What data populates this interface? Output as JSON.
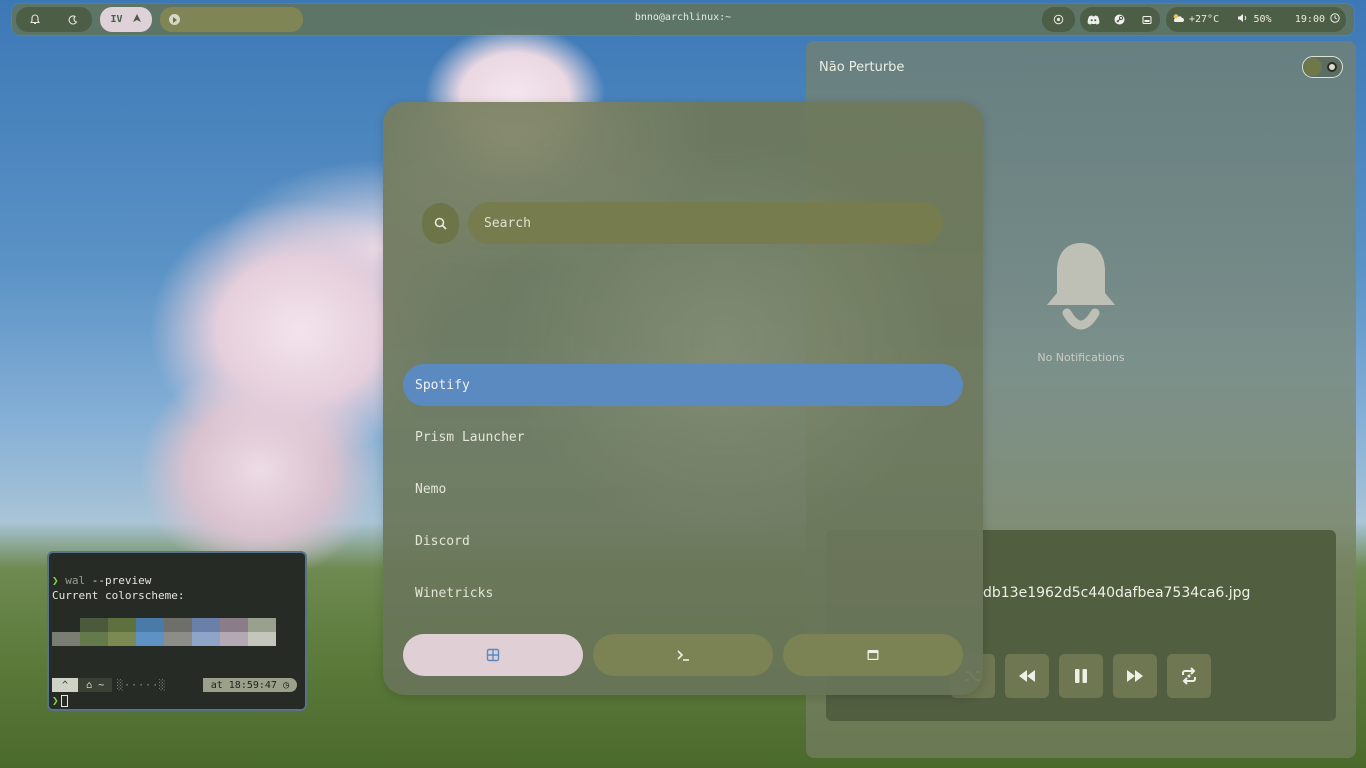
{
  "topbar": {
    "window_title": "bnno@archlinux:~",
    "workspace_label": "IV",
    "weather": "+27°C",
    "volume": "50%",
    "clock": "19:00"
  },
  "notifications": {
    "title": "Não Perturbe",
    "empty_text": "No Notifications",
    "dnd_enabled": false
  },
  "media": {
    "track_title": "db13e1962d5c440dafbea7534ca6.jpg"
  },
  "launcher": {
    "search_placeholder": "Search",
    "apps": [
      {
        "label": "Spotify",
        "selected": true
      },
      {
        "label": "Prism Launcher",
        "selected": false
      },
      {
        "label": "Nemo",
        "selected": false
      },
      {
        "label": "Discord",
        "selected": false
      },
      {
        "label": "Winetricks",
        "selected": false
      }
    ],
    "tabs": [
      {
        "icon": "grid-icon",
        "active": true
      },
      {
        "icon": "terminal-icon",
        "active": false
      },
      {
        "icon": "window-icon",
        "active": false
      }
    ]
  },
  "terminal": {
    "prompt_symbol": "❯",
    "command": "wal",
    "command_args": " --preview",
    "output_line": "Current colorscheme:",
    "status_a": "^",
    "status_b": "⌂ ~",
    "status_c": "at 18:59:47 ◷",
    "palette_top": [
      "#272b26",
      "#4a5a3a",
      "#5f7040",
      "#4a7aa8",
      "#6e6e6a",
      "#6a80a8",
      "#8a7c88",
      "#9aa08e"
    ],
    "palette_bottom": [
      "#7a7d72",
      "#647a4a",
      "#7a8a52",
      "#5f92c4",
      "#8c8c88",
      "#8ea4c8",
      "#b4a8b4",
      "#c4c6bc"
    ]
  },
  "colors": {
    "accent_blue": "#5b8ac0",
    "panel_olive": "#525e40",
    "active_tab_pink": "#e0d0d6"
  }
}
